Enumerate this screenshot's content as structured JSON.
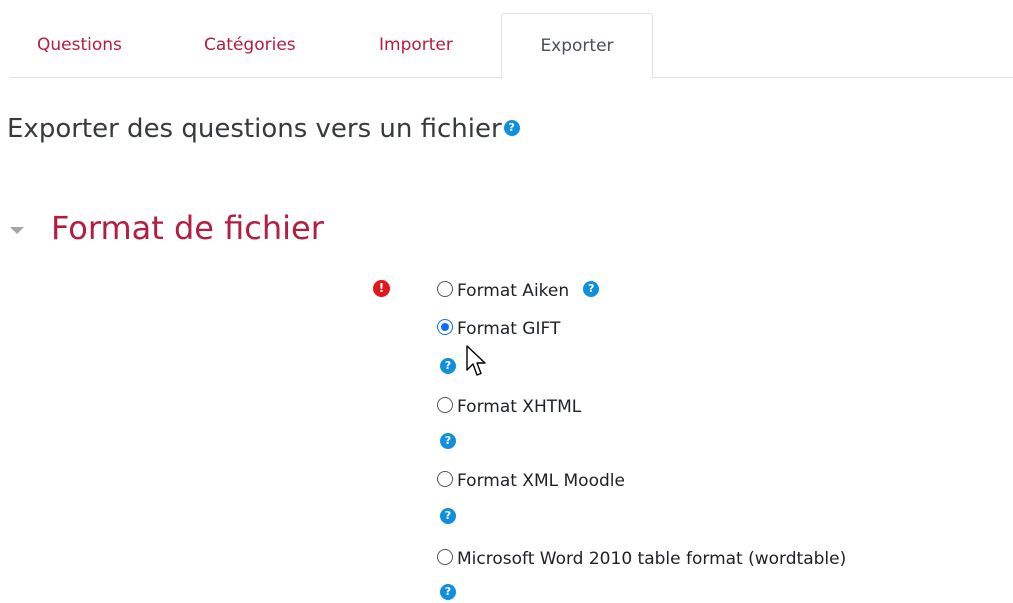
{
  "tabs": [
    {
      "label": "Questions",
      "active": false
    },
    {
      "label": "Catégories",
      "active": false
    },
    {
      "label": "Importer",
      "active": false
    },
    {
      "label": "Exporter",
      "active": true
    }
  ],
  "page_title": "Exporter des questions vers un fichier",
  "section": {
    "title": "Format de fichier",
    "expanded": true
  },
  "required_icon_glyph": "!",
  "help_glyph": "?",
  "options": [
    {
      "label": "Format Aiken",
      "checked": false
    },
    {
      "label": "Format GIFT",
      "checked": true
    },
    {
      "label": "Format XHTML",
      "checked": false
    },
    {
      "label": "Format XML Moodle",
      "checked": false
    },
    {
      "label": "Microsoft Word 2010 table format (wordtable)",
      "checked": false
    }
  ],
  "colors": {
    "accent": "#b21d40",
    "help": "#0f8fde",
    "required": "#e0171d",
    "radio_checked": "#0d6efd"
  }
}
